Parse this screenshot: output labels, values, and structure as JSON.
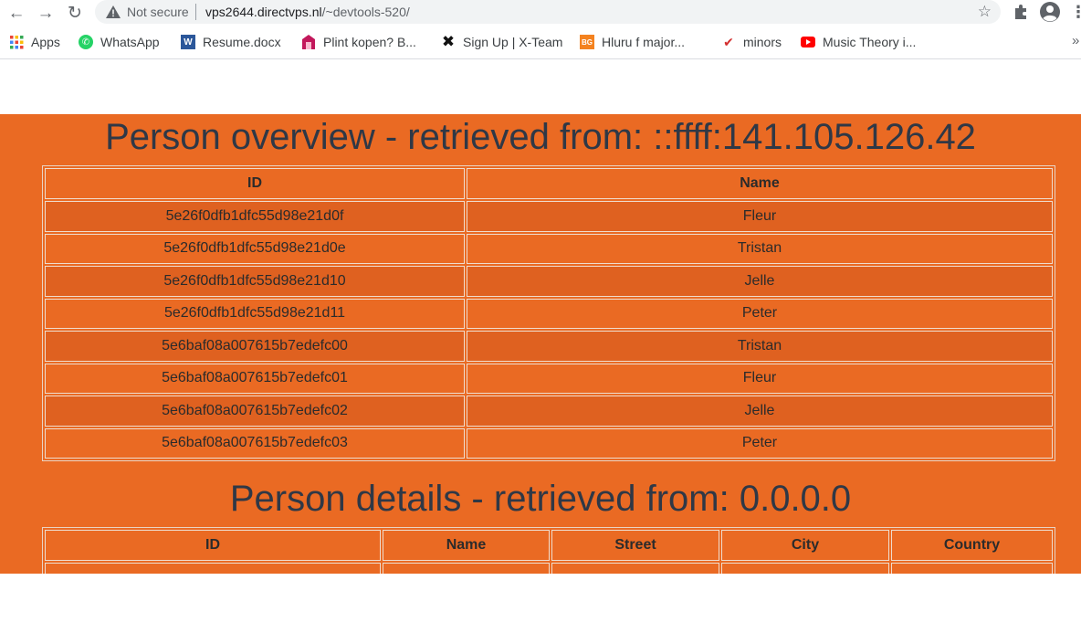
{
  "browser": {
    "security_label": "Not secure",
    "url_host": "vps2644.directvps.nl",
    "url_path": "/~devtools-520/",
    "bookmarks": [
      {
        "label": "Apps",
        "icon": "apps-grid-icon"
      },
      {
        "label": "WhatsApp",
        "icon": "whatsapp-icon"
      },
      {
        "label": "Resume.docx",
        "icon": "word-icon"
      },
      {
        "label": "Plint kopen? B...",
        "icon": "plint-icon"
      },
      {
        "label": "Sign Up | X-Team",
        "icon": "x-team-icon"
      },
      {
        "label": "Hluru f major...",
        "icon": "bg-icon"
      },
      {
        "label": "minors",
        "icon": "check-icon"
      },
      {
        "label": "Music Theory i...",
        "icon": "youtube-icon"
      }
    ],
    "more_bookmarks": "»"
  },
  "overview": {
    "title": "Person overview - retrieved from: ::ffff:141.105.126.42",
    "headers": [
      "ID",
      "Name"
    ],
    "rows": [
      [
        "5e26f0dfb1dfc55d98e21d0f",
        "Fleur"
      ],
      [
        "5e26f0dfb1dfc55d98e21d0e",
        "Tristan"
      ],
      [
        "5e26f0dfb1dfc55d98e21d10",
        "Jelle"
      ],
      [
        "5e26f0dfb1dfc55d98e21d11",
        "Peter"
      ],
      [
        "5e6baf08a007615b7edefc00",
        "Tristan"
      ],
      [
        "5e6baf08a007615b7edefc01",
        "Fleur"
      ],
      [
        "5e6baf08a007615b7edefc02",
        "Jelle"
      ],
      [
        "5e6baf08a007615b7edefc03",
        "Peter"
      ]
    ]
  },
  "details": {
    "title": "Person details - retrieved from: 0.0.0.0",
    "headers": [
      "ID",
      "Name",
      "Street",
      "City",
      "Country"
    ]
  },
  "colors": {
    "page_background": "#ea6a23",
    "row_alt": "#df6120",
    "heading_text": "#2f3846"
  }
}
